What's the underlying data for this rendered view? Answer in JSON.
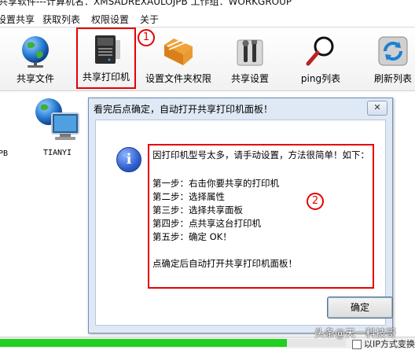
{
  "window": {
    "title": "共享软件---计算机名：XMSADREXAULOJPB  工作组：WORKGROUP"
  },
  "menu": [
    {
      "label": "设置共享"
    },
    {
      "label": "获取列表"
    },
    {
      "label": "权限设置"
    },
    {
      "label": "关于"
    }
  ],
  "toolbar": [
    {
      "label": "共享文件",
      "icon": "globe-icon"
    },
    {
      "label": "共享打印机",
      "icon": "printer-icon"
    },
    {
      "label": "设置文件夹权限",
      "icon": "folder-icon"
    },
    {
      "label": "共享设置",
      "icon": "tools-icon"
    },
    {
      "label": "ping列表",
      "icon": "magnifier-icon"
    },
    {
      "label": "刷新列表",
      "icon": "refresh-icon"
    }
  ],
  "annotations": {
    "step1": "1",
    "step2": "2"
  },
  "devices": [
    {
      "label": "PB"
    },
    {
      "label": "TIANYI"
    }
  ],
  "dialog": {
    "title": "看完后点确定，自动打开共享打印机面板！",
    "close": "✕",
    "icon_glyph": "i",
    "message": [
      "因打印机型号太多，请手动设置，方法很简单！如下：",
      "第一步：右击你要共享的打印机",
      "第二步：选择属性",
      "第三步：选择共享面板",
      "第四步：点共享这台打印机",
      "第五步：确定   OK！",
      "点确定后自动打开共享打印机面板！"
    ],
    "ok_label": "确定"
  },
  "status": {
    "progress": 0.83,
    "checkbox_label": "以IP方式变换",
    "colors": {
      "progress": "#1fd01f"
    }
  },
  "watermark": "头条@天一科技哥"
}
